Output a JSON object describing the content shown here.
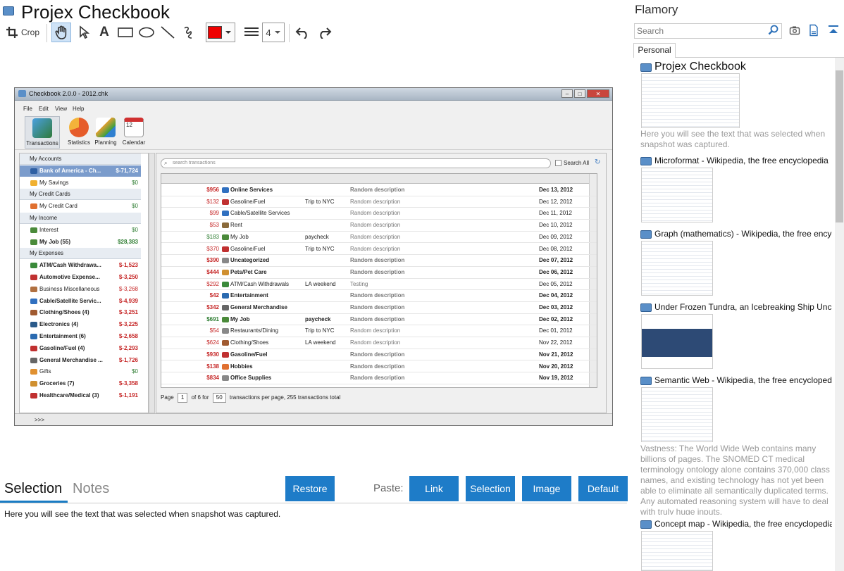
{
  "app": {
    "title": "Projex Checkbook"
  },
  "toolbar": {
    "crop_label": "Crop",
    "line_width": "4",
    "color": "#ee0000"
  },
  "screenshot": {
    "title": "Checkbook 2.0.0 - 2012.chk",
    "menu": [
      "File",
      "Edit",
      "View",
      "Help"
    ],
    "ribbon": [
      "Transactions",
      "Statistics",
      "Planning",
      "Calendar"
    ],
    "calendar_day": "12",
    "accounts": [
      {
        "name": "My Accounts",
        "value": "",
        "header": true
      },
      {
        "name": "Bank of America - Ch...",
        "value": "$-71,724",
        "selected": true,
        "bold": true,
        "icon": "#2e5fa3"
      },
      {
        "name": "My Savings",
        "value": "$0",
        "icon": "#f0b030"
      },
      {
        "name": "My Credit Cards",
        "value": "",
        "header": true
      },
      {
        "name": "My Credit Card",
        "value": "$0",
        "icon": "#e07030"
      },
      {
        "name": "My Income",
        "value": "",
        "header": true
      },
      {
        "name": "Interest",
        "value": "$0",
        "icon": "#4a8a3a"
      },
      {
        "name": "My Job (55)",
        "value": "$28,383",
        "bold": true,
        "icon": "#4a8a3a"
      },
      {
        "name": "My Expenses",
        "value": "",
        "header": true
      },
      {
        "name": "ATM/Cash Withdrawa...",
        "value": "$-1,523",
        "bold": true,
        "icon": "#3a8a3a"
      },
      {
        "name": "Automotive Expense...",
        "value": "$-3,250",
        "bold": true,
        "icon": "#c03030"
      },
      {
        "name": "Business Miscellaneous",
        "value": "$-3,268",
        "icon": "#b07040"
      },
      {
        "name": "Cable/Satellite Servic...",
        "value": "$-4,939",
        "bold": true,
        "icon": "#3070c0"
      },
      {
        "name": "Clothing/Shoes (4)",
        "value": "$-3,251",
        "bold": true,
        "icon": "#a05a30"
      },
      {
        "name": "Electronics (4)",
        "value": "$-3,225",
        "bold": true,
        "icon": "#2a5a8a"
      },
      {
        "name": "Entertainment (6)",
        "value": "$-2,658",
        "bold": true,
        "icon": "#2a6ab0"
      },
      {
        "name": "Gasoline/Fuel (4)",
        "value": "$-2,293",
        "bold": true,
        "icon": "#c03030"
      },
      {
        "name": "General Merchandise ...",
        "value": "$-1,726",
        "bold": true,
        "icon": "#666666"
      },
      {
        "name": "Gifts",
        "value": "$0",
        "icon": "#e09030"
      },
      {
        "name": "Groceries (7)",
        "value": "$-3,358",
        "bold": true,
        "icon": "#d09030"
      },
      {
        "name": "Healthcare/Medical (3)",
        "value": "$-1,191",
        "bold": true,
        "icon": "#c03030"
      }
    ],
    "search_placeholder": "search transactions",
    "search_all_label": "Search All",
    "transactions": [
      {
        "amount": "$956",
        "category": "Online Services",
        "memo": "",
        "desc": "Random description",
        "date": "Dec 13, 2012",
        "bold": true,
        "icon": "#3070c0"
      },
      {
        "amount": "$132",
        "category": "Gasoline/Fuel",
        "memo": "Trip to NYC",
        "desc": "Random description",
        "date": "Dec 12, 2012",
        "icon": "#c03030"
      },
      {
        "amount": "$99",
        "category": "Cable/Satellite Services",
        "memo": "",
        "desc": "Random description",
        "date": "Dec 11, 2012",
        "icon": "#3070c0"
      },
      {
        "amount": "$53",
        "category": "Rent",
        "memo": "",
        "desc": "Random description",
        "date": "Dec 10, 2012",
        "icon": "#8a6a3a"
      },
      {
        "amount": "$183",
        "category": "My Job",
        "memo": "paycheck",
        "desc": "Random description",
        "date": "Dec 09, 2012",
        "positive": true,
        "icon": "#4a8a3a"
      },
      {
        "amount": "$370",
        "category": "Gasoline/Fuel",
        "memo": "Trip to NYC",
        "desc": "Random description",
        "date": "Dec 08, 2012",
        "icon": "#c03030"
      },
      {
        "amount": "$390",
        "category": "Uncategorized",
        "memo": "",
        "desc": "Random description",
        "date": "Dec 07, 2012",
        "bold": true,
        "icon": "#888888"
      },
      {
        "amount": "$444",
        "category": "Pets/Pet Care",
        "memo": "",
        "desc": "Random description",
        "date": "Dec 06, 2012",
        "bold": true,
        "icon": "#d09030"
      },
      {
        "amount": "$292",
        "category": "ATM/Cash Withdrawals",
        "memo": "LA weekend",
        "desc": "Testing",
        "date": "Dec 05, 2012",
        "icon": "#3a8a3a"
      },
      {
        "amount": "$42",
        "category": "Entertainment",
        "memo": "",
        "desc": "Random description",
        "date": "Dec 04, 2012",
        "bold": true,
        "icon": "#2a6ab0"
      },
      {
        "amount": "$342",
        "category": "General Merchandise",
        "memo": "",
        "desc": "Random description",
        "date": "Dec 03, 2012",
        "bold": true,
        "icon": "#666666"
      },
      {
        "amount": "$691",
        "category": "My Job",
        "memo": "paycheck",
        "desc": "Random description",
        "date": "Dec 02, 2012",
        "bold": true,
        "positive": true,
        "icon": "#4a8a3a"
      },
      {
        "amount": "$54",
        "category": "Restaurants/Dining",
        "memo": "Trip to NYC",
        "desc": "Random description",
        "date": "Dec 01, 2012",
        "icon": "#888888"
      },
      {
        "amount": "$624",
        "category": "Clothing/Shoes",
        "memo": "LA weekend",
        "desc": "Random description",
        "date": "Nov 22, 2012",
        "icon": "#a05a30"
      },
      {
        "amount": "$930",
        "category": "Gasoline/Fuel",
        "memo": "",
        "desc": "Random description",
        "date": "Nov 21, 2012",
        "bold": true,
        "icon": "#c03030"
      },
      {
        "amount": "$138",
        "category": "Hobbies",
        "memo": "",
        "desc": "Random description",
        "date": "Nov 20, 2012",
        "bold": true,
        "icon": "#e07030"
      },
      {
        "amount": "$834",
        "category": "Office Supplies",
        "memo": "",
        "desc": "Random description",
        "date": "Nov 19, 2012",
        "bold": true,
        "icon": "#888888"
      }
    ],
    "pager": {
      "page_label": "Page",
      "page": "1",
      "of_label": "of 6 for",
      "per_page": "50",
      "suffix": "transactions per page, 255 transactions total"
    },
    "status_prompt": ">>>"
  },
  "tabs": {
    "selection": "Selection",
    "notes": "Notes"
  },
  "buttons": {
    "restore": "Restore",
    "paste_label": "Paste:",
    "link": "Link",
    "selection": "Selection",
    "image": "Image",
    "default": "Default"
  },
  "selection_text": "Here you will see the text that was selected when snapshot was captured.",
  "sidebar": {
    "title": "Flamory",
    "search_placeholder": "Search",
    "tab": "Personal",
    "items": [
      {
        "title": "Projex Checkbook",
        "text": "Here you will see the text that was selected when snapshot was captured."
      },
      {
        "title": "Microformat - Wikipedia, the free encyclopedia"
      },
      {
        "title": "Graph (mathematics) - Wikipedia, the free encyclopedia"
      },
      {
        "title": "Under Frozen Tundra, an Icebreaking Ship Uncovers..."
      },
      {
        "title": "Semantic Web - Wikipedia, the free encyclopedia",
        "text": "Vastness: The World Wide Web contains many billions of pages. The SNOMED CT medical terminology ontology alone contains 370,000 class names, and existing technology has not yet been able to eliminate all semantically duplicated terms. Any automated reasoning system will have to deal with truly huge inputs."
      },
      {
        "title": "Concept map - Wikipedia, the free encyclopedia"
      }
    ]
  }
}
